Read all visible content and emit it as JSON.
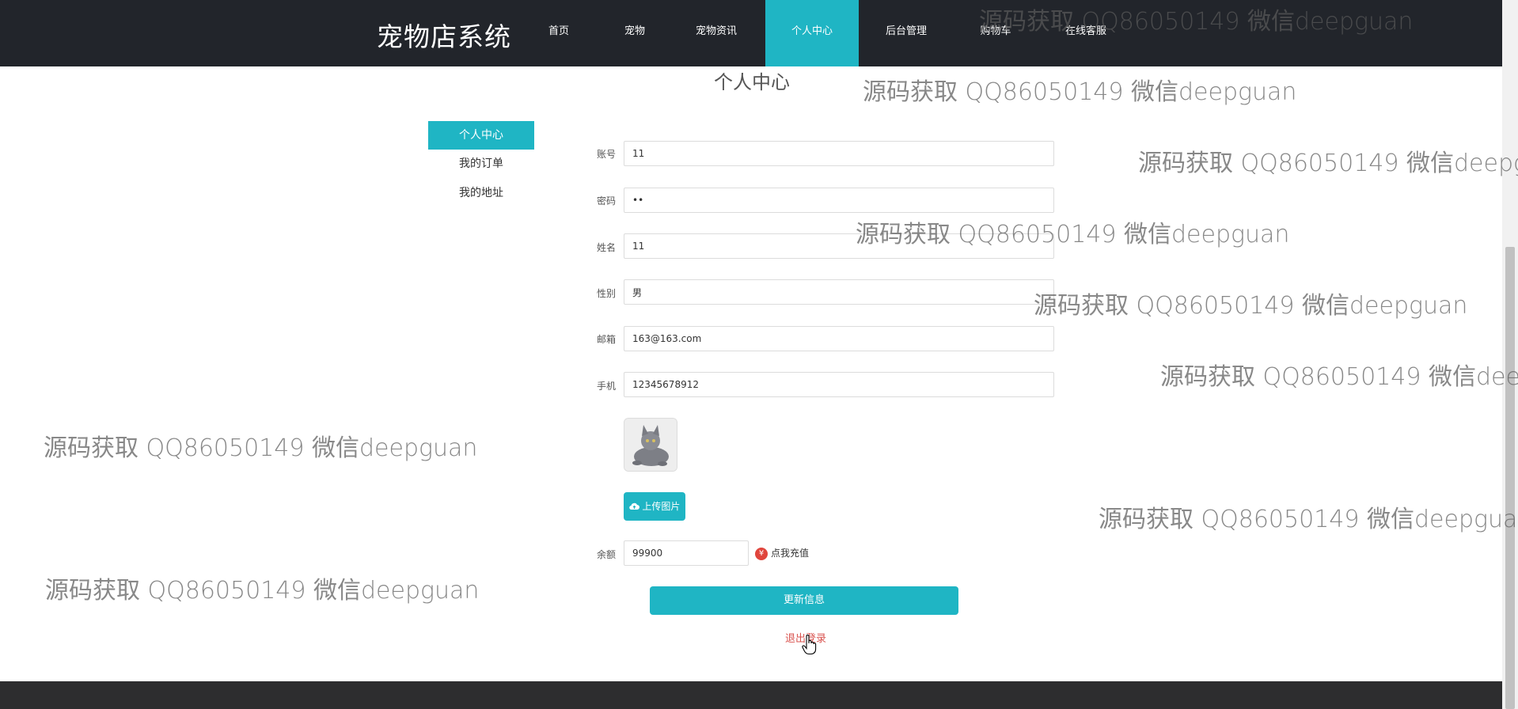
{
  "header": {
    "brand": "宠物店系统",
    "nav": [
      {
        "label": "首页"
      },
      {
        "label": "宠物"
      },
      {
        "label": "宠物资讯"
      },
      {
        "label": "个人中心",
        "active": true
      },
      {
        "label": "后台管理"
      },
      {
        "label": "购物车"
      },
      {
        "label": "在线客服"
      }
    ]
  },
  "page": {
    "title": "个人中心"
  },
  "sidebar": {
    "items": [
      {
        "label": "个人中心",
        "active": true
      },
      {
        "label": "我的订单"
      },
      {
        "label": "我的地址"
      }
    ]
  },
  "form": {
    "fields": [
      {
        "label": "账号",
        "value": "11"
      },
      {
        "label": "密码",
        "value": "••"
      },
      {
        "label": "姓名",
        "value": "11"
      },
      {
        "label": "性别",
        "value": "男"
      },
      {
        "label": "邮箱",
        "value": "163@163.com"
      },
      {
        "label": "手机",
        "value": "12345678912"
      }
    ],
    "upload_label": "上传图片",
    "balance_label": "余额",
    "balance_value": "99900",
    "recharge_label": "点我充值",
    "update_label": "更新信息",
    "logout_label": "退出登录"
  },
  "watermark": "源码获取 QQ86050149 微信deepguan",
  "colors": {
    "accent": "#1fb5c4",
    "nav_bg": "#22252b",
    "footer_bg": "#2d2d2f",
    "logout": "#d9534f"
  },
  "icons": {
    "upload": "cloud-upload-icon",
    "recharge": "yen-icon",
    "cursor": "hand-cursor-icon"
  }
}
